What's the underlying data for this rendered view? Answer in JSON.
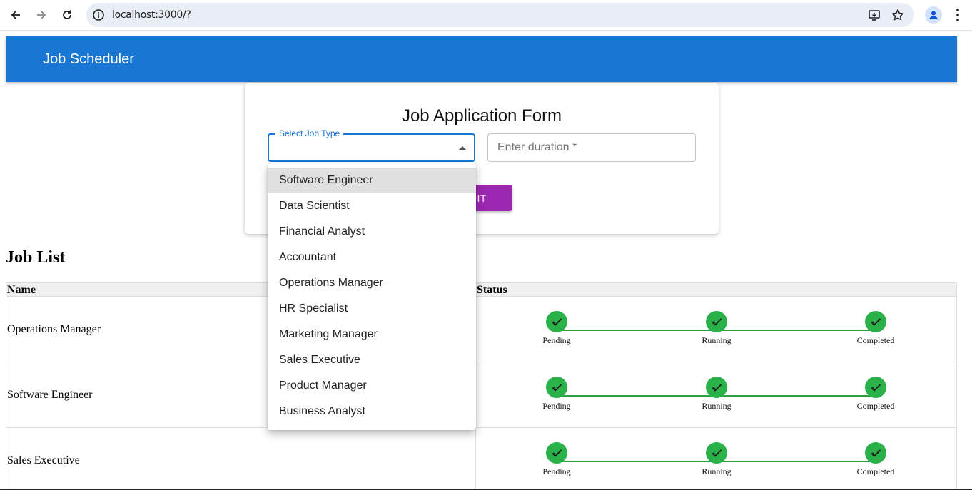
{
  "browser": {
    "url": "localhost:3000/?"
  },
  "app": {
    "title": "Job Scheduler"
  },
  "form": {
    "title": "Job Application Form",
    "job_type_label": "Select Job Type",
    "duration_placeholder": "Enter duration *",
    "submit_label": "SUBMIT"
  },
  "dropdown": {
    "options": [
      "Software Engineer",
      "Data Scientist",
      "Financial Analyst",
      "Accountant",
      "Operations Manager",
      "HR Specialist",
      "Marketing Manager",
      "Sales Executive",
      "Product Manager",
      "Business Analyst"
    ],
    "highlighted": "Software Engineer"
  },
  "job_list": {
    "title": "Job List",
    "headers": {
      "name": "Name",
      "status": "Status"
    },
    "steps": [
      "Pending",
      "Running",
      "Completed"
    ],
    "rows": [
      {
        "name": "Operations Manager"
      },
      {
        "name": "Software Engineer"
      },
      {
        "name": "Sales Executive"
      }
    ]
  },
  "colors": {
    "app_bar": "#1976d2",
    "submit": "#9c27b0",
    "step_complete": "#2bb14a"
  }
}
